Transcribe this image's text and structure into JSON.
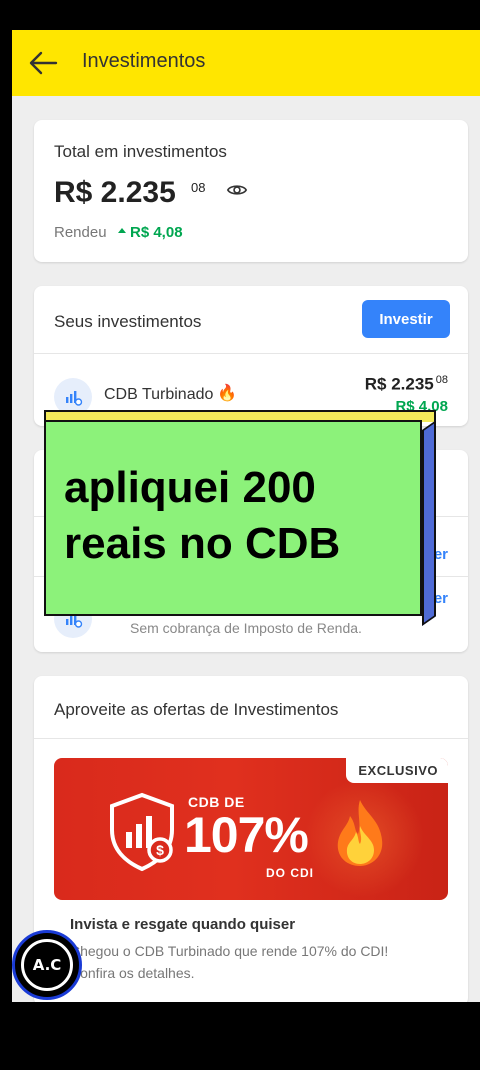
{
  "appbar": {
    "title": "Investimentos"
  },
  "total": {
    "label": "Total em investimentos",
    "value": "R$ 2.235",
    "cents": "08",
    "rendeu_label": "Rendeu",
    "rendeu_value": "R$ 4,08"
  },
  "seus": {
    "title": "Seus investimentos",
    "button": "Investir",
    "items": [
      {
        "name": "CDB Turbinado",
        "emoji": "🔥",
        "value": "R$ 2.235",
        "cents": "08",
        "gain": "R$ 4,08"
      }
    ]
  },
  "mid": {
    "row1_link": "Conhecer",
    "row2_link": "Conhecer",
    "row2_subtitle": "Sem cobrança de Imposto de Renda."
  },
  "ofertas": {
    "title": "Aproveite as ofertas de Investimentos",
    "promo": {
      "badge": "EXCLUSIVO",
      "cdb_de": "CDB DE",
      "rate": "107%",
      "do_cdi": "DO CDI",
      "headline": "Invista e resgate quando quiser",
      "description": "Chegou o CDB Turbinado que rende 107% do CDI! Confira os detalhes."
    }
  },
  "overlay": {
    "line1": "apliquei 200",
    "line2": "reais no CDB"
  },
  "logo": {
    "text": "A.C"
  },
  "colors": {
    "appbar": "#ffe600",
    "accent": "#3483fa",
    "gain": "#00a650",
    "overlay": "#8cf27a"
  }
}
